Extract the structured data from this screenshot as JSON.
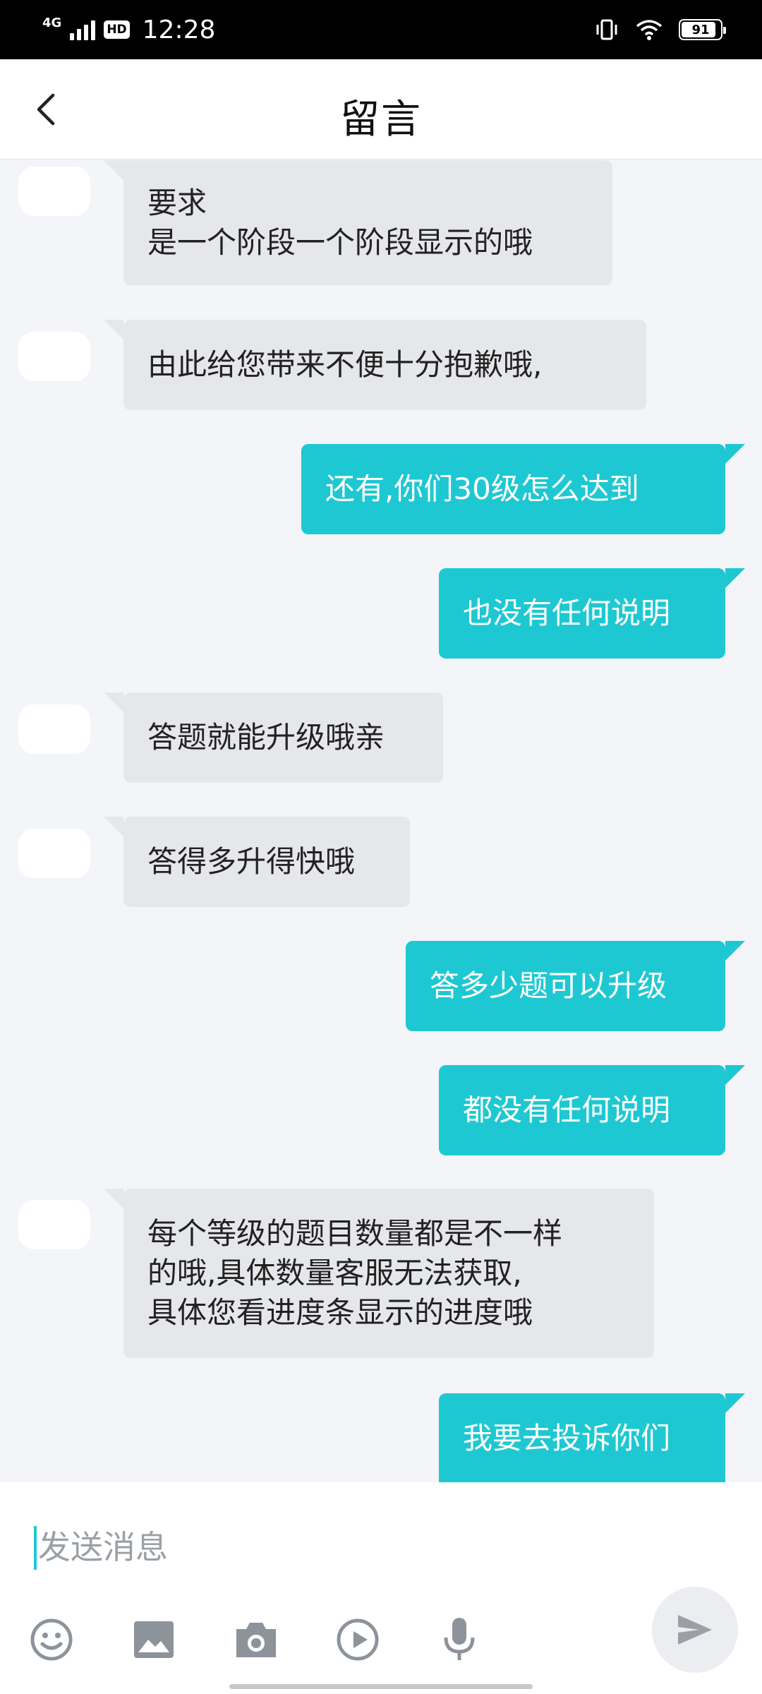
{
  "status_bar": {
    "network": "4G",
    "hd_badge": "HD",
    "time": "12:28",
    "battery_level": "91",
    "icons": [
      "signal-icon",
      "vibrate-icon",
      "wifi-icon",
      "battery-icon"
    ]
  },
  "header": {
    "title": "留言",
    "back_icon": "chevron-left-icon"
  },
  "messages": [
    {
      "side": "in",
      "text": "要求\n是一个阶段一个阶段显示的哦"
    },
    {
      "side": "in",
      "text": "由此给您带来不便十分抱歉哦,"
    },
    {
      "side": "out",
      "text": "还有,你们30级怎么达到"
    },
    {
      "side": "out",
      "text": "也没有任何说明"
    },
    {
      "side": "in",
      "text": "答题就能升级哦亲"
    },
    {
      "side": "in",
      "text": "答得多升得快哦"
    },
    {
      "side": "out",
      "text": "答多少题可以升级"
    },
    {
      "side": "out",
      "text": "都没有任何说明"
    },
    {
      "side": "in",
      "text": "每个等级的题目数量都是不一样\n的哦,具体数量客服无法获取,\n具体您看进度条显示的进度哦"
    },
    {
      "side": "out",
      "text": "我要去投诉你们"
    }
  ],
  "composer": {
    "placeholder": "发送消息",
    "value": "",
    "tools": [
      "emoji-icon",
      "image-icon",
      "camera-icon",
      "video-play-icon",
      "microphone-icon"
    ],
    "send_icon": "send-icon"
  },
  "colors": {
    "accent": "#1ec8d2",
    "incoming_bubble": "#e6e7ea",
    "background": "#f3f5f8"
  }
}
